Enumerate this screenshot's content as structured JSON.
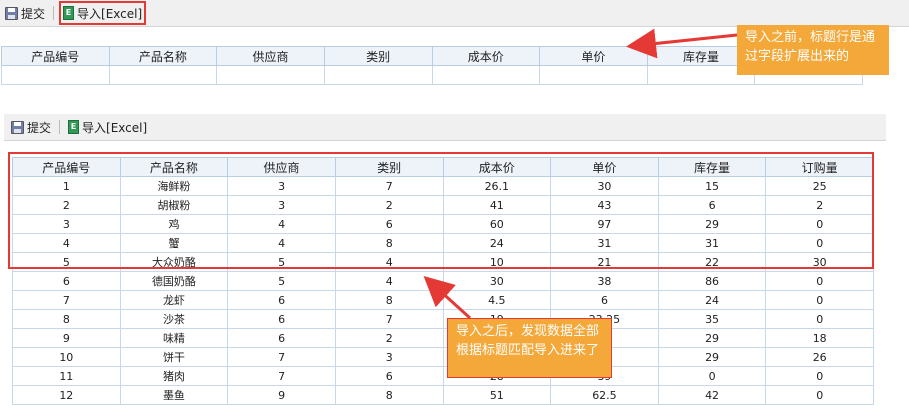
{
  "top": {
    "toolbar": {
      "submit_label": "提交",
      "import_label": "导入[Excel]"
    },
    "headers": [
      "产品编号",
      "产品名称",
      "供应商",
      "类别",
      "成本价",
      "单价",
      "库存量",
      ""
    ]
  },
  "bottom": {
    "toolbar": {
      "submit_label": "提交",
      "import_label": "导入[Excel]"
    },
    "headers": [
      "产品编号",
      "产品名称",
      "供应商",
      "类别",
      "成本价",
      "单价",
      "库存量",
      "订购量"
    ],
    "rows": [
      [
        "1",
        "海鲜粉",
        "3",
        "7",
        "26.1",
        "30",
        "15",
        "25"
      ],
      [
        "2",
        "胡椒粉",
        "3",
        "2",
        "41",
        "43",
        "6",
        "2"
      ],
      [
        "3",
        "鸡",
        "4",
        "6",
        "60",
        "97",
        "29",
        "0"
      ],
      [
        "4",
        "蟹",
        "4",
        "8",
        "24",
        "31",
        "31",
        "0"
      ],
      [
        "5",
        "大众奶酪",
        "5",
        "4",
        "10",
        "21",
        "22",
        "30"
      ],
      [
        "6",
        "德国奶酪",
        "5",
        "4",
        "30",
        "38",
        "86",
        "0"
      ],
      [
        "7",
        "龙虾",
        "6",
        "8",
        "4.5",
        "6",
        "24",
        "0"
      ],
      [
        "8",
        "沙茶",
        "6",
        "7",
        "19",
        "23.25",
        "35",
        "0"
      ],
      [
        "9",
        "味精",
        "6",
        "2",
        "",
        "",
        "29",
        "18"
      ],
      [
        "10",
        "饼干",
        "7",
        "3",
        "",
        "",
        "29",
        "26"
      ],
      [
        "11",
        "猪肉",
        "7",
        "6",
        "28",
        "39",
        "0",
        "0"
      ],
      [
        "12",
        "墨鱼",
        "9",
        "8",
        "51",
        "62.5",
        "42",
        "0"
      ]
    ]
  },
  "callouts": {
    "top": "导入之前，标题行是通过字段扩展出来的",
    "bottom": "导入之后，发现数据全部根据标题匹配导入进来了"
  },
  "colors": {
    "highlight": "#e53935",
    "callout": "#f4a83a"
  }
}
